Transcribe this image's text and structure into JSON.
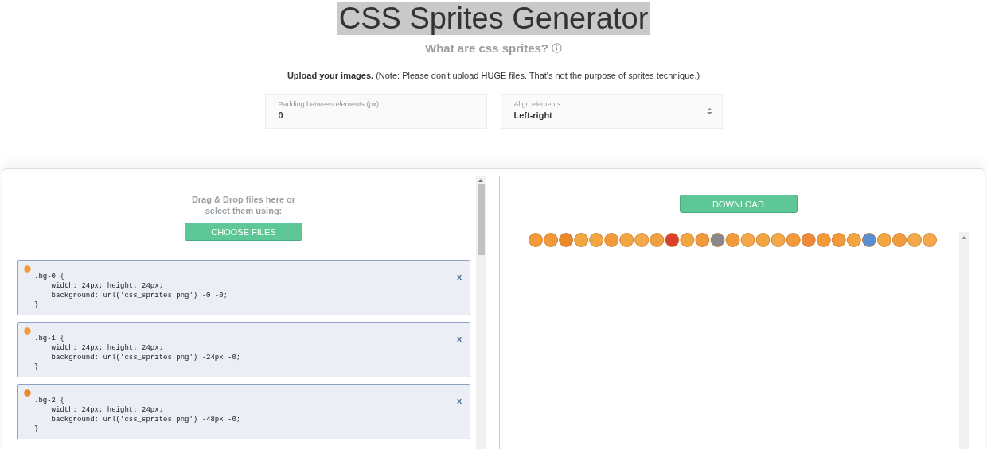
{
  "title": "CSS Sprites Generator",
  "subtitle": "What are css sprites?",
  "note": "**Upload your images.** (Note: Please don't upload HUGE files. That's not the purpose of sprites technique.)",
  "fields": [
    {
      "kind": "input",
      "label": "Padding between elements (px):",
      "value": "0"
    },
    {
      "kind": "select",
      "label": "Align elements:",
      "value": "Left-right"
    }
  ],
  "dropzone": {
    "text": "Drag & Drop files here or\nselect them using:",
    "button": "CHOOSE FILES"
  },
  "css_rules": [
    {
      "code": ".bg-0 {\n    width: 24px; height: 24px;\n    background: url('css_sprites.png') -0 -0;\n}",
      "close": "x"
    },
    {
      "code": ".bg-1 {\n    width: 24px; height: 24px;\n    background: url('css_sprites.png') -24px -0;\n}",
      "close": "x"
    },
    {
      "code": ".bg-2 {\n    width: 24px; height: 24px;\n    background: url('css_sprites.png') -48px -0;\n}",
      "close": "x"
    }
  ],
  "download": "DOWNLOAD"
}
